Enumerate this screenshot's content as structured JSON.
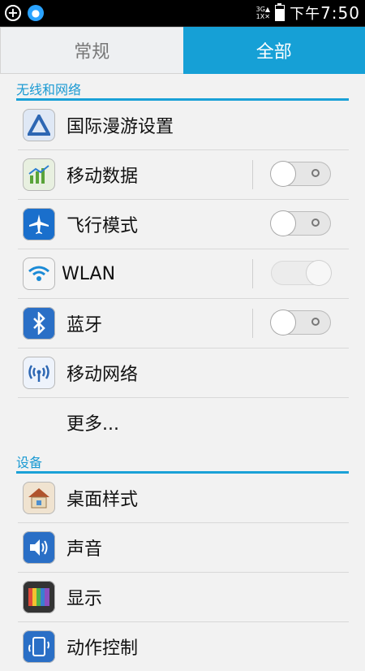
{
  "status": {
    "network_top": "3G",
    "network_bottom": "1X",
    "time_prefix": "下午",
    "time": "7:50"
  },
  "tabs": {
    "general": "常规",
    "all": "全部"
  },
  "sections": {
    "wireless": "无线和网络",
    "device": "设备"
  },
  "wireless_items": [
    {
      "label": "国际漫游设置"
    },
    {
      "label": "移动数据"
    },
    {
      "label": "飞行模式"
    },
    {
      "label": "WLAN"
    },
    {
      "label": "蓝牙"
    },
    {
      "label": "移动网络"
    }
  ],
  "more": {
    "label": "更多..."
  },
  "device_items": [
    {
      "label": "桌面样式"
    },
    {
      "label": "声音"
    },
    {
      "label": "显示"
    },
    {
      "label": "动作控制"
    }
  ],
  "colors": {
    "accent": "#16a0d6"
  }
}
